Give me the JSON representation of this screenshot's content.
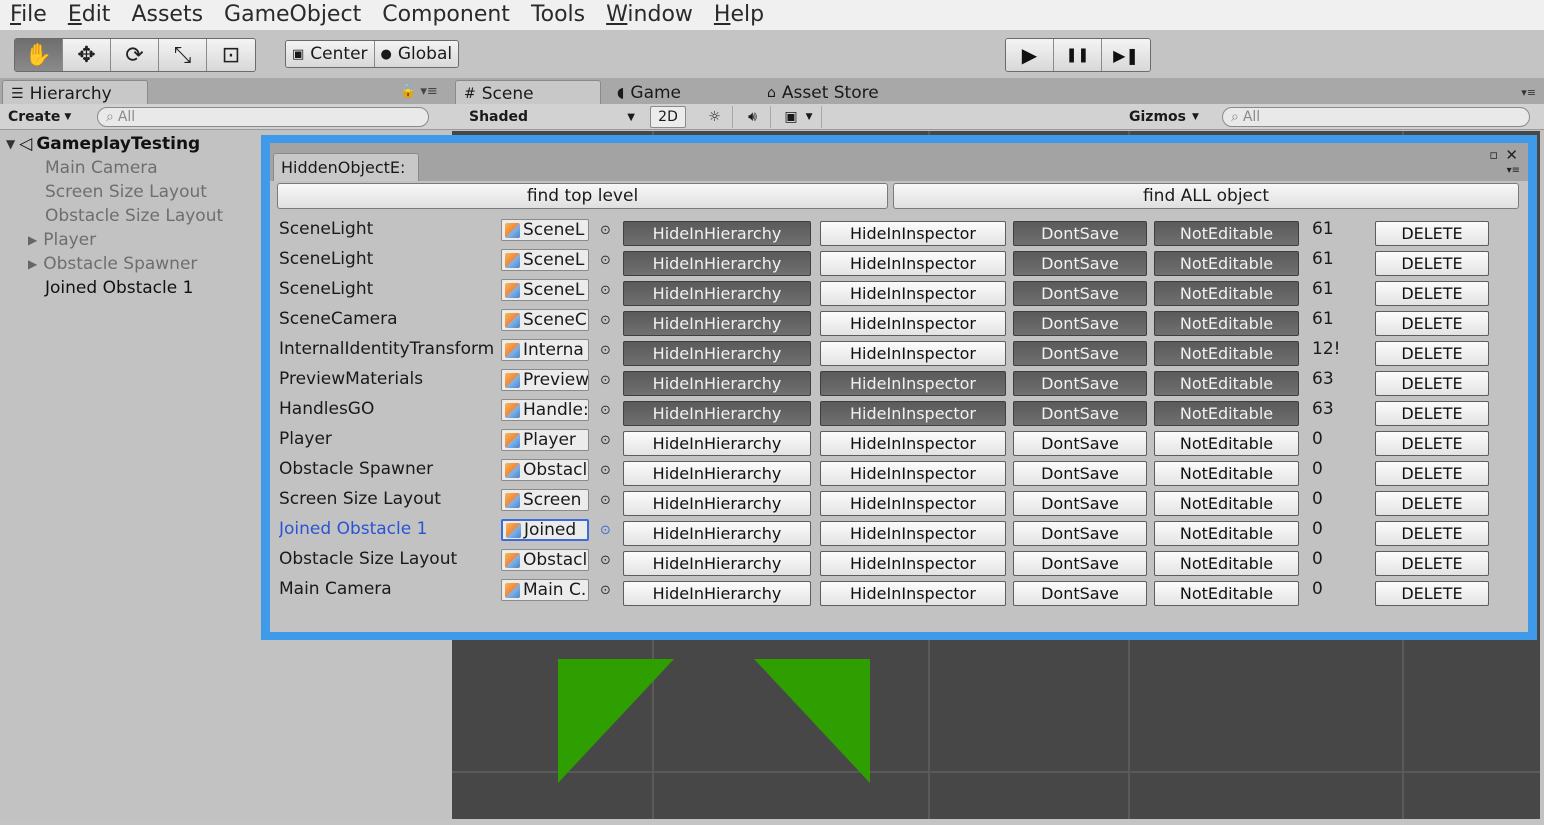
{
  "menu": [
    {
      "label": "File",
      "u": "F",
      "rest": "ile"
    },
    {
      "label": "Edit",
      "u": "E",
      "rest": "dit"
    },
    {
      "label": "Assets",
      "u": "",
      "rest": "Assets"
    },
    {
      "label": "GameObject",
      "u": "",
      "rest": "GameObject"
    },
    {
      "label": "Component",
      "u": "",
      "rest": "Component"
    },
    {
      "label": "Tools",
      "u": "",
      "rest": "Tools"
    },
    {
      "label": "Window",
      "u": "W",
      "rest": "indow"
    },
    {
      "label": "Help",
      "u": "H",
      "rest": "elp"
    }
  ],
  "toolbar": {
    "tools": [
      {
        "name": "hand-tool-icon",
        "glyph": "✋",
        "active": true
      },
      {
        "name": "move-tool-icon",
        "glyph": "✥",
        "active": false
      },
      {
        "name": "rotate-tool-icon",
        "glyph": "⟳",
        "active": false
      },
      {
        "name": "scale-tool-icon",
        "glyph": "⤡",
        "active": false
      },
      {
        "name": "rect-tool-icon",
        "glyph": "⊡",
        "active": false
      }
    ],
    "pivot_label": "Center",
    "space_label": "Global",
    "play_icons": [
      "▶",
      "❚❚",
      "▶❚"
    ]
  },
  "hierarchy": {
    "tab_label": "Hierarchy",
    "create_label": "Create",
    "search_placeholder": "All",
    "root": "GameplayTesting",
    "items": [
      "Main Camera",
      "Screen Size Layout",
      "Obstacle Size Layout",
      "Player",
      "Obstacle Spawner",
      "Joined Obstacle 1"
    ]
  },
  "scene": {
    "tabs": [
      "Scene",
      "Game",
      "Asset Store"
    ],
    "shading": "Shaded",
    "mode_2d": "2D",
    "gizmos": "Gizmos",
    "search_placeholder": "All"
  },
  "window": {
    "title": "HiddenObjectE:",
    "find_top": "find top level",
    "find_all": "find ALL object",
    "btn_labels": {
      "hide_hier": "HideInHierarchy",
      "hide_insp": "HideInInspector",
      "dont_save": "DontSave",
      "not_editable": "NotEditable",
      "delete": "DELETE"
    },
    "rows": [
      {
        "name": "SceneLight",
        "field": "SceneL",
        "b1": true,
        "b2": false,
        "b3": true,
        "b4": true,
        "layer": "61"
      },
      {
        "name": "SceneLight",
        "field": "SceneL",
        "b1": true,
        "b2": false,
        "b3": true,
        "b4": true,
        "layer": "61"
      },
      {
        "name": "SceneLight",
        "field": "SceneL",
        "b1": true,
        "b2": false,
        "b3": true,
        "b4": true,
        "layer": "61"
      },
      {
        "name": "SceneCamera",
        "field": "SceneC",
        "b1": true,
        "b2": false,
        "b3": true,
        "b4": true,
        "layer": "61"
      },
      {
        "name": "InternalIdentityTransform",
        "field": "Interna",
        "b1": true,
        "b2": false,
        "b3": true,
        "b4": true,
        "layer": "12!"
      },
      {
        "name": "PreviewMaterials",
        "field": "Preview",
        "b1": true,
        "b2": true,
        "b3": true,
        "b4": true,
        "layer": "63"
      },
      {
        "name": "HandlesGO",
        "field": "Handle:",
        "b1": true,
        "b2": true,
        "b3": true,
        "b4": true,
        "layer": "63"
      },
      {
        "name": "Player",
        "field": "Player",
        "b1": false,
        "b2": false,
        "b3": false,
        "b4": false,
        "layer": "0"
      },
      {
        "name": "Obstacle Spawner",
        "field": "Obstacl",
        "b1": false,
        "b2": false,
        "b3": false,
        "b4": false,
        "layer": "0"
      },
      {
        "name": "Screen Size Layout",
        "field": "Screen",
        "b1": false,
        "b2": false,
        "b3": false,
        "b4": false,
        "layer": "0"
      },
      {
        "name": "Joined Obstacle 1",
        "field": "Joined",
        "b1": false,
        "b2": false,
        "b3": false,
        "b4": false,
        "layer": "0",
        "selected": true
      },
      {
        "name": "Obstacle Size Layout",
        "field": "Obstacl",
        "b1": false,
        "b2": false,
        "b3": false,
        "b4": false,
        "layer": "0"
      },
      {
        "name": "Main Camera",
        "field": "Main C.",
        "b1": false,
        "b2": false,
        "b3": false,
        "b4": false,
        "layer": "0"
      }
    ]
  },
  "colors": {
    "selection_blue": "#3f9bea",
    "active_button": "#5a5a5a",
    "triangle_green": "#2f9e00"
  }
}
